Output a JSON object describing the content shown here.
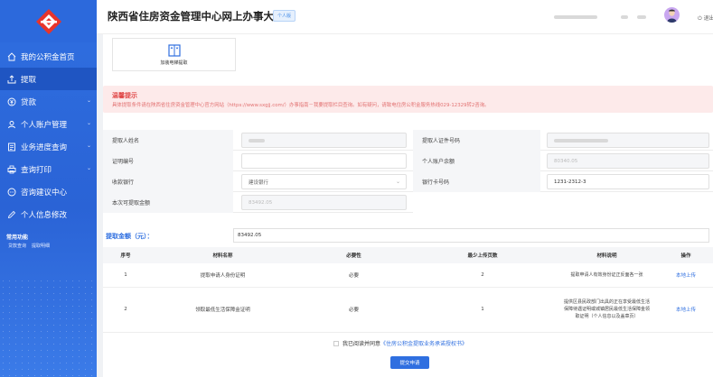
{
  "header": {
    "title": "陕西省住房资金管理中心网上办事大厅",
    "tag": "个人版",
    "logout": "退出"
  },
  "sidebar": {
    "items": [
      {
        "label": "我的公积金首页",
        "icon": "home-icon",
        "chevron": false
      },
      {
        "label": "提取",
        "icon": "withdraw-icon",
        "chevron": false
      },
      {
        "label": "贷款",
        "icon": "loan-icon",
        "chevron": true
      },
      {
        "label": "个人账户管理",
        "icon": "user-icon",
        "chevron": true
      },
      {
        "label": "业务进度查询",
        "icon": "progress-icon",
        "chevron": true
      },
      {
        "label": "查询打印",
        "icon": "print-icon",
        "chevron": true
      },
      {
        "label": "咨询建议中心",
        "icon": "chat-icon",
        "chevron": false
      },
      {
        "label": "个人信息修改",
        "icon": "edit-icon",
        "chevron": false
      }
    ],
    "common_title": "常用功能",
    "common_links": [
      "贷款查询",
      "提取明细"
    ]
  },
  "widget": {
    "label": "加装电梯提取"
  },
  "notice": {
    "title": "温馨提示",
    "text": "具体提取条件请在陕西省住房资金管理中心官方网站（https://www.sxgjj.com/）办事指南－我要提取栏目查询。如有疑问，请致电住房公积金服务热线029-12329转2咨询。"
  },
  "form": {
    "name_label": "提取人姓名",
    "id_label": "提取人证件号码",
    "cert_label": "证明编号",
    "balance_label": "个人账户余额",
    "balance_value": "80340.05",
    "bank_label": "收款银行",
    "bank_value": "建设银行",
    "card_label": "银行卡号码",
    "card_value": "1231-2312-3",
    "max_label": "本次可提取金额",
    "max_value": "83492.05"
  },
  "amount": {
    "label": "提取金额（元）：",
    "value": "83492.05"
  },
  "table": {
    "headers": [
      "序号",
      "材料名称",
      "必要性",
      "最少上传页数",
      "材料说明",
      "操作"
    ],
    "rows": [
      {
        "no": "1",
        "name": "提取申请人身份证明",
        "need": "必要",
        "pages": "2",
        "desc": "提取申请人有效身份证正反面各一张",
        "action": "本地上传"
      },
      {
        "no": "2",
        "name": "领取最低生活保障金证明",
        "need": "必要",
        "pages": "1",
        "desc": "提供区县民政部门出具的正在享受最低生活保障待遇证明或城镇居民最低生活保障金领取证明（个人信息以及盖章页）",
        "action": "本地上传"
      }
    ]
  },
  "agree": {
    "prefix": "我已阅读并同意",
    "link": "《住房公积金提取业务承诺授权书》"
  },
  "submit": {
    "label": "提交申请"
  },
  "colors": {
    "primary": "#2f6fe0",
    "sidebar": "#2a63d6",
    "notice_bg": "#fdeaea",
    "notice_text": "#e04646"
  }
}
